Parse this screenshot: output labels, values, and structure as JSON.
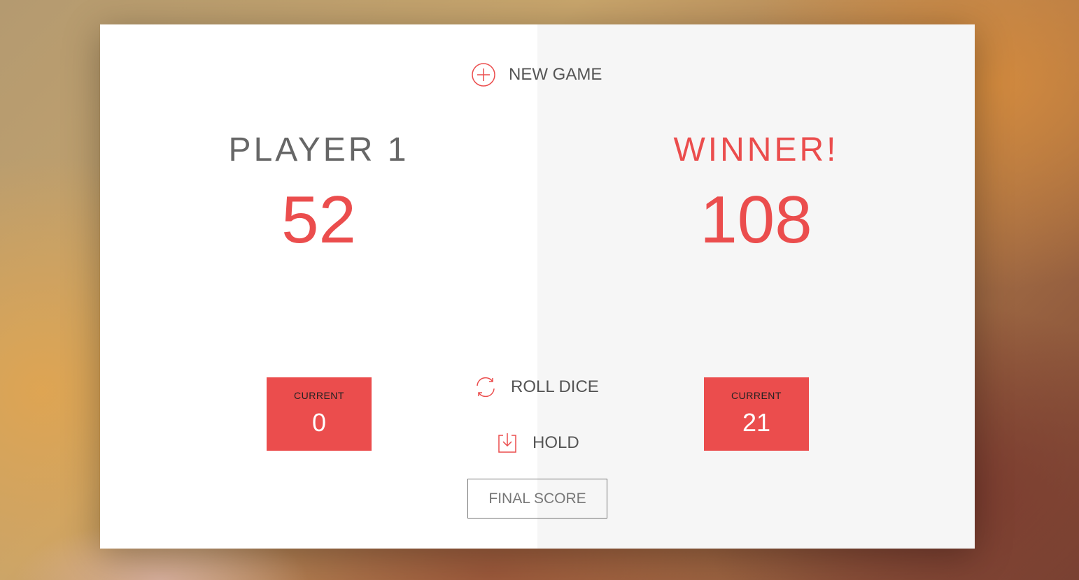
{
  "buttons": {
    "new_game": "NEW GAME",
    "roll_dice": "ROLL DICE",
    "hold": "HOLD"
  },
  "final_score": {
    "placeholder": "FINAL SCORE",
    "value": ""
  },
  "players": [
    {
      "name": "PLAYER 1",
      "score": "52",
      "current_label": "CURRENT",
      "current": "0",
      "active": false
    },
    {
      "name": "WINNER!",
      "score": "108",
      "current_label": "CURRENT",
      "current": "21",
      "active": true
    }
  ],
  "colors": {
    "accent": "#eb4d4d",
    "panel_left": "#ffffff",
    "panel_right": "#f6f6f6",
    "text": "#555555"
  },
  "icons": {
    "new_game": "circle-plus-icon",
    "roll_dice": "refresh-icon",
    "hold": "download-icon"
  }
}
